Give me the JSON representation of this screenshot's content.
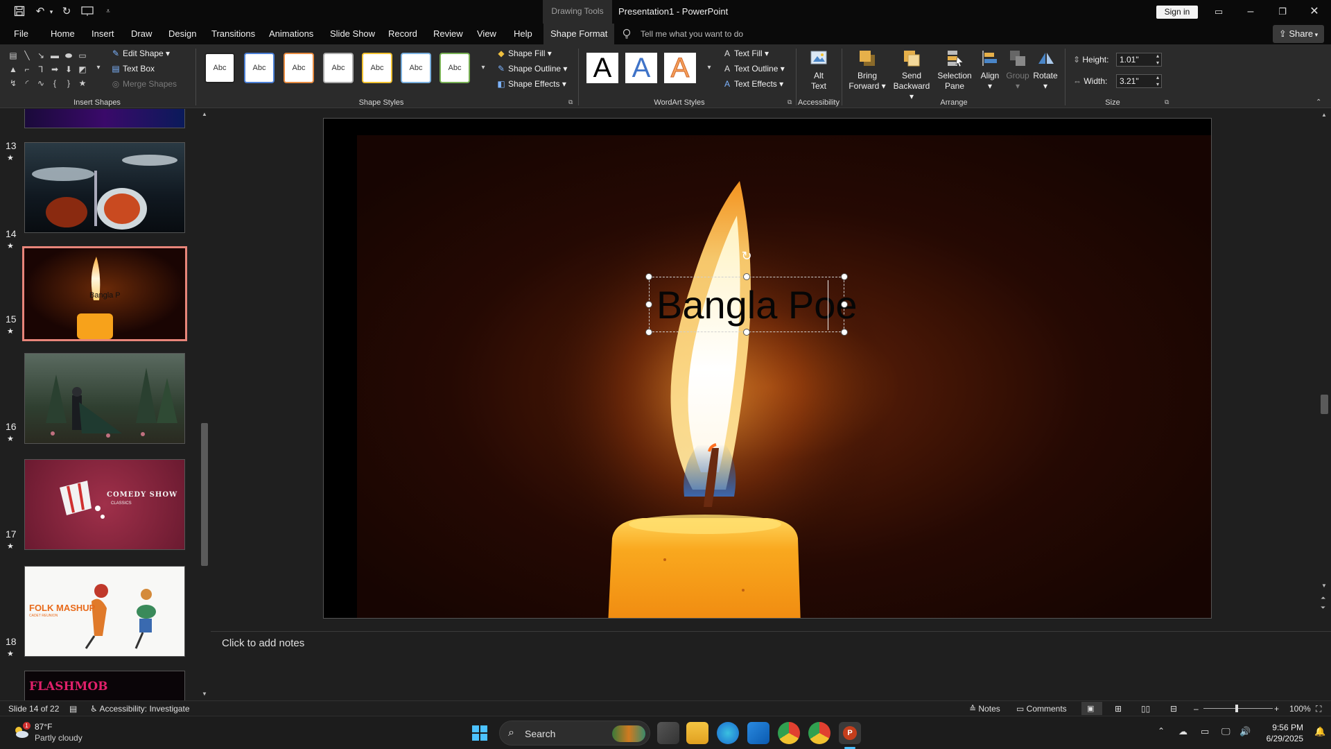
{
  "titlebar": {
    "context_tab": "Drawing Tools",
    "document_title": "Presentation1  -  PowerPoint",
    "sign_in": "Sign in"
  },
  "tabs": [
    "File",
    "Home",
    "Insert",
    "Draw",
    "Design",
    "Transitions",
    "Animations",
    "Slide Show",
    "Record",
    "Review",
    "View",
    "Help",
    "Shape Format"
  ],
  "active_tab": "Shape Format",
  "tell_me": "Tell me what you want to do",
  "share": "Share",
  "ribbon": {
    "insert_shapes": {
      "label": "Insert Shapes",
      "edit_shape": "Edit Shape",
      "text_box": "Text Box",
      "merge_shapes": "Merge Shapes"
    },
    "shape_styles": {
      "label": "Shape Styles",
      "preset_text": "Abc",
      "shape_fill": "Shape Fill",
      "shape_outline": "Shape Outline",
      "shape_effects": "Shape Effects"
    },
    "wordart_styles": {
      "label": "WordArt Styles",
      "preset_letter": "A",
      "text_fill": "Text Fill",
      "text_outline": "Text Outline",
      "text_effects": "Text Effects"
    },
    "accessibility": {
      "label": "Accessibility",
      "alt_text_1": "Alt",
      "alt_text_2": "Text"
    },
    "arrange": {
      "label": "Arrange",
      "bring_forward_1": "Bring",
      "bring_forward_2": "Forward",
      "send_backward_1": "Send",
      "send_backward_2": "Backward",
      "selection_pane_1": "Selection",
      "selection_pane_2": "Pane",
      "align": "Align",
      "group": "Group",
      "rotate": "Rotate"
    },
    "size": {
      "label": "Size",
      "height_label": "Height:",
      "height_value": "1.01\"",
      "width_label": "Width:",
      "width_value": "3.21\""
    }
  },
  "thumbnails": [
    {
      "number": "13",
      "star": "★"
    },
    {
      "number": "14",
      "star": "★",
      "text": "Bangla P"
    },
    {
      "number": "15",
      "star": "★"
    },
    {
      "number": "16",
      "star": "★",
      "text": "COMEDY SHOW",
      "subtext": "CLASSICS"
    },
    {
      "number": "17",
      "star": "★",
      "text": "FOLK MASHUP",
      "subtext": "CADET REUNION"
    },
    {
      "number": "18",
      "star": "★",
      "text": "FLASHMOB"
    }
  ],
  "slide": {
    "textbox_text": "Bangla Poe"
  },
  "notes_placeholder": "Click to add notes",
  "statusbar": {
    "slide_info": "Slide 14 of 22",
    "accessibility": "Accessibility: Investigate",
    "notes": "Notes",
    "comments": "Comments",
    "zoom": "100%"
  },
  "taskbar": {
    "weather_temp": "87°F",
    "weather_desc": "Partly cloudy",
    "weather_badge": "1",
    "search": "Search",
    "time": "9:56 PM",
    "date": "6/29/2025"
  },
  "colors": {
    "accent_tab": "#2b2b2b",
    "selected_thumb_border": "#e8857a",
    "flame_core": "#fff6d0",
    "candle": "#f7a21b",
    "pp_red": "#c43e1c"
  }
}
